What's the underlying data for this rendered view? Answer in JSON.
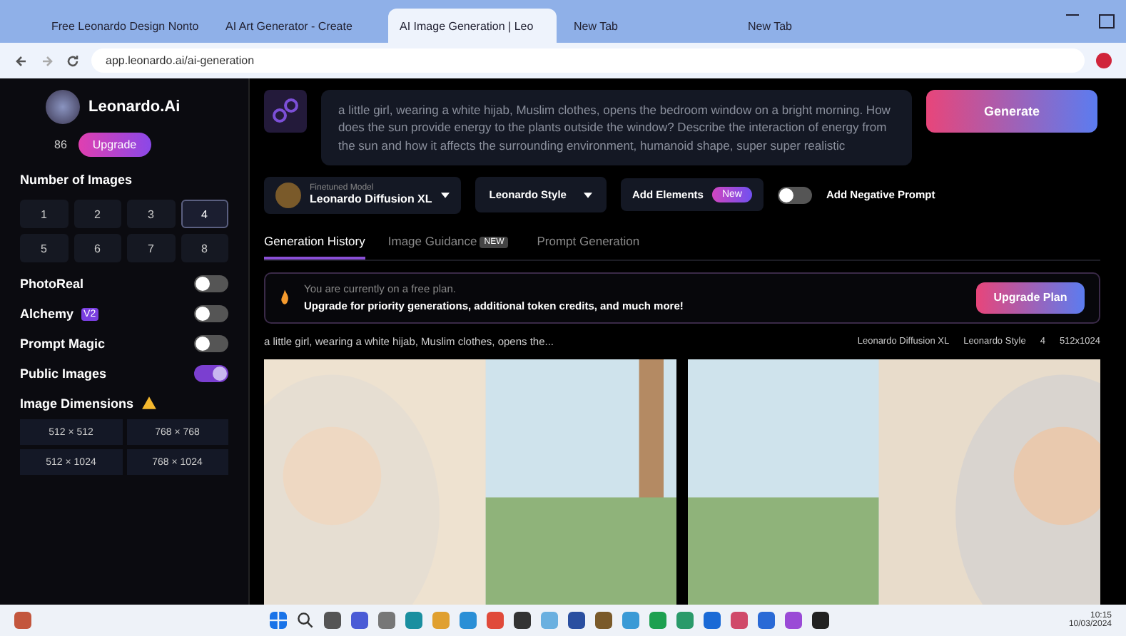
{
  "browser": {
    "tabs": [
      {
        "title": "Free Leonardo Design Nonto",
        "selected": false
      },
      {
        "title": "AI Art Generator - Create",
        "selected": false
      },
      {
        "title": "AI Image Generation | Leo",
        "selected": true
      },
      {
        "title": "New Tab",
        "selected": false
      },
      {
        "title": "New Tab",
        "selected": false
      }
    ],
    "url": "app.leonardo.ai/ai-generation"
  },
  "sidebar": {
    "brand": "Leonardo.Ai",
    "tokens": "86",
    "upgrade": "Upgrade",
    "number_of_images": {
      "label": "Number of Images",
      "options": [
        {
          "label": "1",
          "selected": false
        },
        {
          "label": "2",
          "selected": false
        },
        {
          "label": "3",
          "selected": false
        },
        {
          "label": "4",
          "selected": true
        },
        {
          "label": "5",
          "selected": false
        },
        {
          "label": "6",
          "selected": false
        },
        {
          "label": "7",
          "selected": false
        },
        {
          "label": "8",
          "selected": false
        }
      ]
    },
    "toggles": [
      {
        "label": "PhotoReal",
        "on": false
      },
      {
        "label": "Alchemy",
        "badge": "V2",
        "on": false
      },
      {
        "label": "Prompt Magic",
        "on": false
      },
      {
        "label": "Public Images",
        "on": true
      }
    ],
    "dimensions": {
      "label": "Image Dimensions",
      "options": [
        "512 × 512",
        "768 × 768",
        "512 × 1024",
        "768 × 1024"
      ]
    }
  },
  "prompt": "a little girl, wearing a white hijab, Muslim clothes, opens the bedroom window on a bright morning. How does the sun provide energy to the plants outside the window? Describe the interaction of energy from the sun and how it affects the surrounding environment, humanoid shape, super super realistic",
  "generate": "Generate",
  "controls": {
    "model_caption": "Finetuned Model",
    "model": "Leonardo Diffusion XL",
    "style": "Leonardo Style",
    "elements": "Add Elements",
    "elements_badge": "New",
    "negative_prompt": {
      "label": "Add Negative Prompt",
      "on": false
    }
  },
  "tabs": [
    {
      "label": "Generation History",
      "selected": true
    },
    {
      "label": "Image Guidance",
      "badge": "NEW",
      "selected": false
    },
    {
      "label": "Prompt Generation",
      "selected": false
    }
  ],
  "banner": {
    "title": "You are currently on a free plan.",
    "text": "Upgrade for priority generations, additional token credits, and much more!",
    "button": "Upgrade Plan"
  },
  "generation": {
    "prompt": "a little girl, wearing a white hijab, Muslim clothes, opens the...",
    "model": "Leonardo Diffusion XL",
    "style": "Leonardo Style",
    "count": "4",
    "size": "512x1024"
  },
  "taskbar": {
    "time": "10:15",
    "date": "10/03/2024"
  }
}
